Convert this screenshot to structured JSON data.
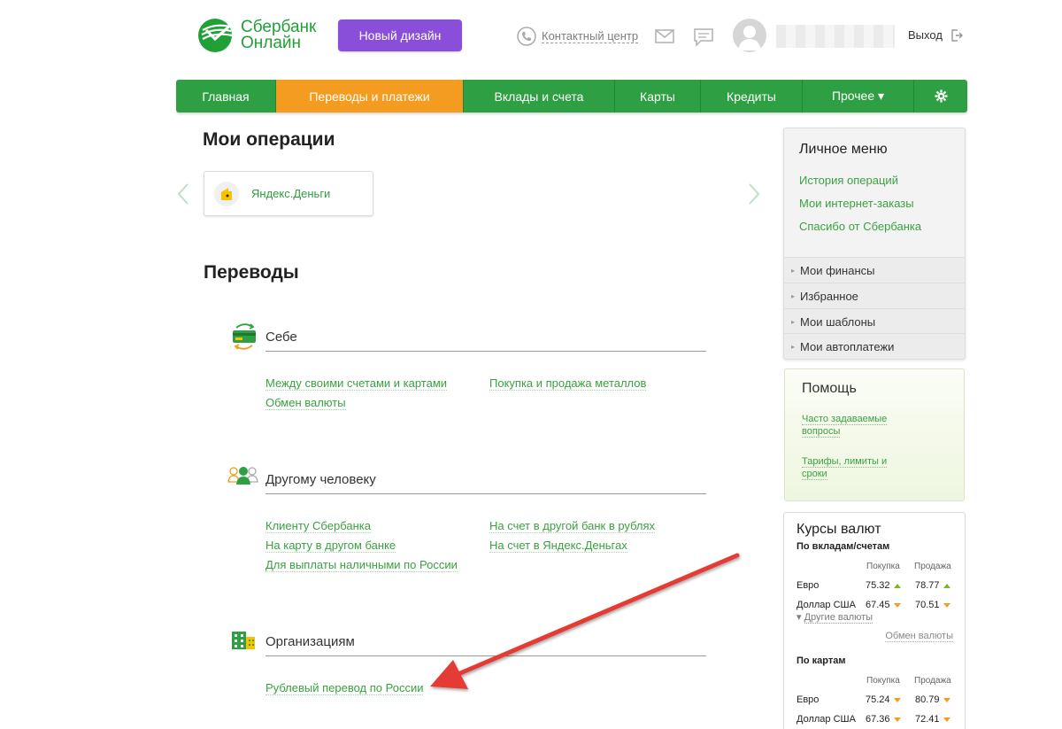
{
  "brand": {
    "line1": "Сбербанк",
    "line2": "Онлайн",
    "color": "#21a038"
  },
  "header": {
    "new_design": "Новый дизайн",
    "contact_center": "Контактный центр",
    "logout": "Выход"
  },
  "nav": {
    "items": [
      {
        "label": "Главная"
      },
      {
        "label": "Переводы и платежи"
      },
      {
        "label": "Вклады и счета"
      },
      {
        "label": "Карты"
      },
      {
        "label": "Кредиты"
      },
      {
        "label": "Прочее ▾"
      }
    ],
    "active_index": 1,
    "accent": "#2ea043",
    "active_color": "#f39c1f"
  },
  "ops": {
    "title": "Мои операции",
    "card_label": "Яндекс.Деньги"
  },
  "transfers": {
    "title": "Переводы",
    "self": {
      "title": "Себе",
      "links": [
        "Между своими счетами и картами",
        "Обмен валюты",
        "Покупка и продажа металлов"
      ]
    },
    "person": {
      "title": "Другому человеку",
      "links": [
        "Клиенту Сбербанка",
        "На карту в другом банке",
        "Для выплаты наличными по России",
        "На счет в другой банк в рублях",
        "На счет в Яндекс.Деньгах"
      ]
    },
    "org": {
      "title": "Организациям",
      "links": [
        "Рублевый перевод по России"
      ]
    }
  },
  "personal_menu": {
    "title": "Личное меню",
    "links": [
      "История операций",
      "Мои интернет-заказы",
      "Спасибо от Сбербанка"
    ],
    "rows": [
      "Мои финансы",
      "Избранное",
      "Мои шаблоны",
      "Мои автоплатежи"
    ]
  },
  "help": {
    "title": "Помощь",
    "faq_l1": "Часто задаваемые",
    "faq_l2": "вопросы",
    "tariffs_l1": "Тарифы, лимиты и",
    "tariffs_l2": "сроки"
  },
  "rates": {
    "title": "Курсы валют",
    "deposits_title": "По вкладам/счетам",
    "cards_title": "По картам",
    "buy_label": "Покупка",
    "sell_label": "Продажа",
    "other_currencies": "Другие валюты",
    "exchange": "Обмен валюты",
    "deposits": [
      {
        "name": "Евро",
        "buy": "75.32",
        "sell": "78.77"
      },
      {
        "name": "Доллар США",
        "buy": "67.45",
        "sell": "70.51"
      }
    ],
    "cards": [
      {
        "name": "Евро",
        "buy": "75.24",
        "sell": "80.79"
      },
      {
        "name": "Доллар США",
        "buy": "67.36",
        "sell": "72.41"
      }
    ]
  }
}
